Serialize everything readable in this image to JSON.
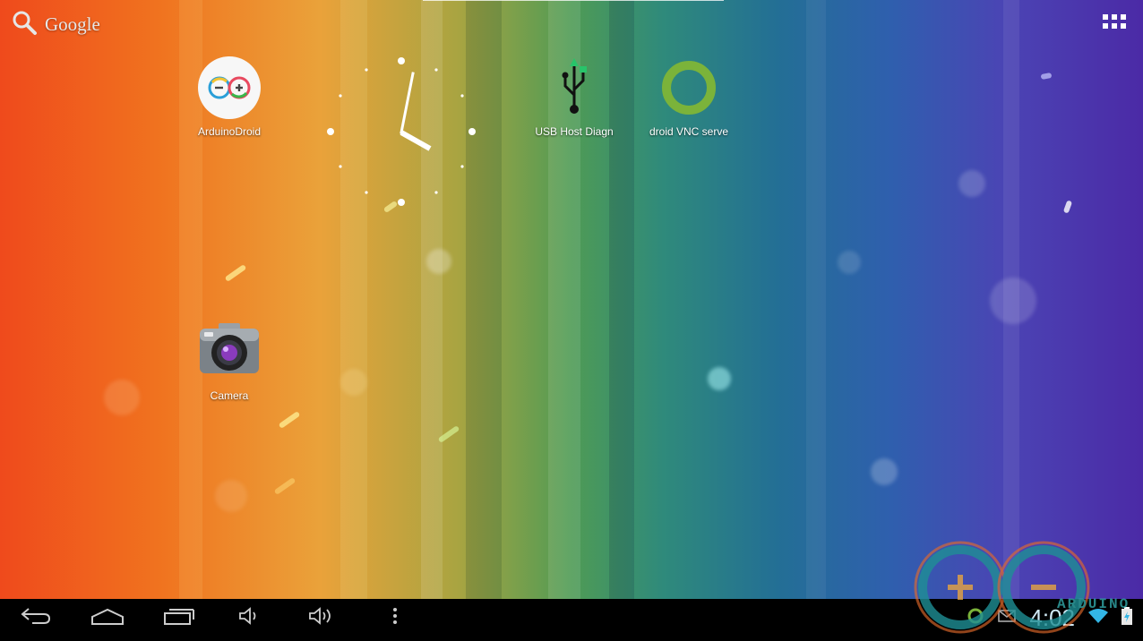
{
  "search": {
    "label": "Google"
  },
  "apps": [
    {
      "name": "ArduinoDroid",
      "icon": "arduino-icon"
    },
    {
      "name": "USB Host Diagn",
      "icon": "usb-icon"
    },
    {
      "name": "droid VNC serve",
      "icon": "vnc-ring-icon"
    },
    {
      "name": "Camera",
      "icon": "camera-icon"
    }
  ],
  "status": {
    "time": "4:02"
  },
  "watermark": {
    "text": "ARDUINO"
  },
  "colors": {
    "vnc_ring": "#7bb33a",
    "usb_accent": "#28c46a",
    "clock_glow": "#cfe8f4"
  }
}
